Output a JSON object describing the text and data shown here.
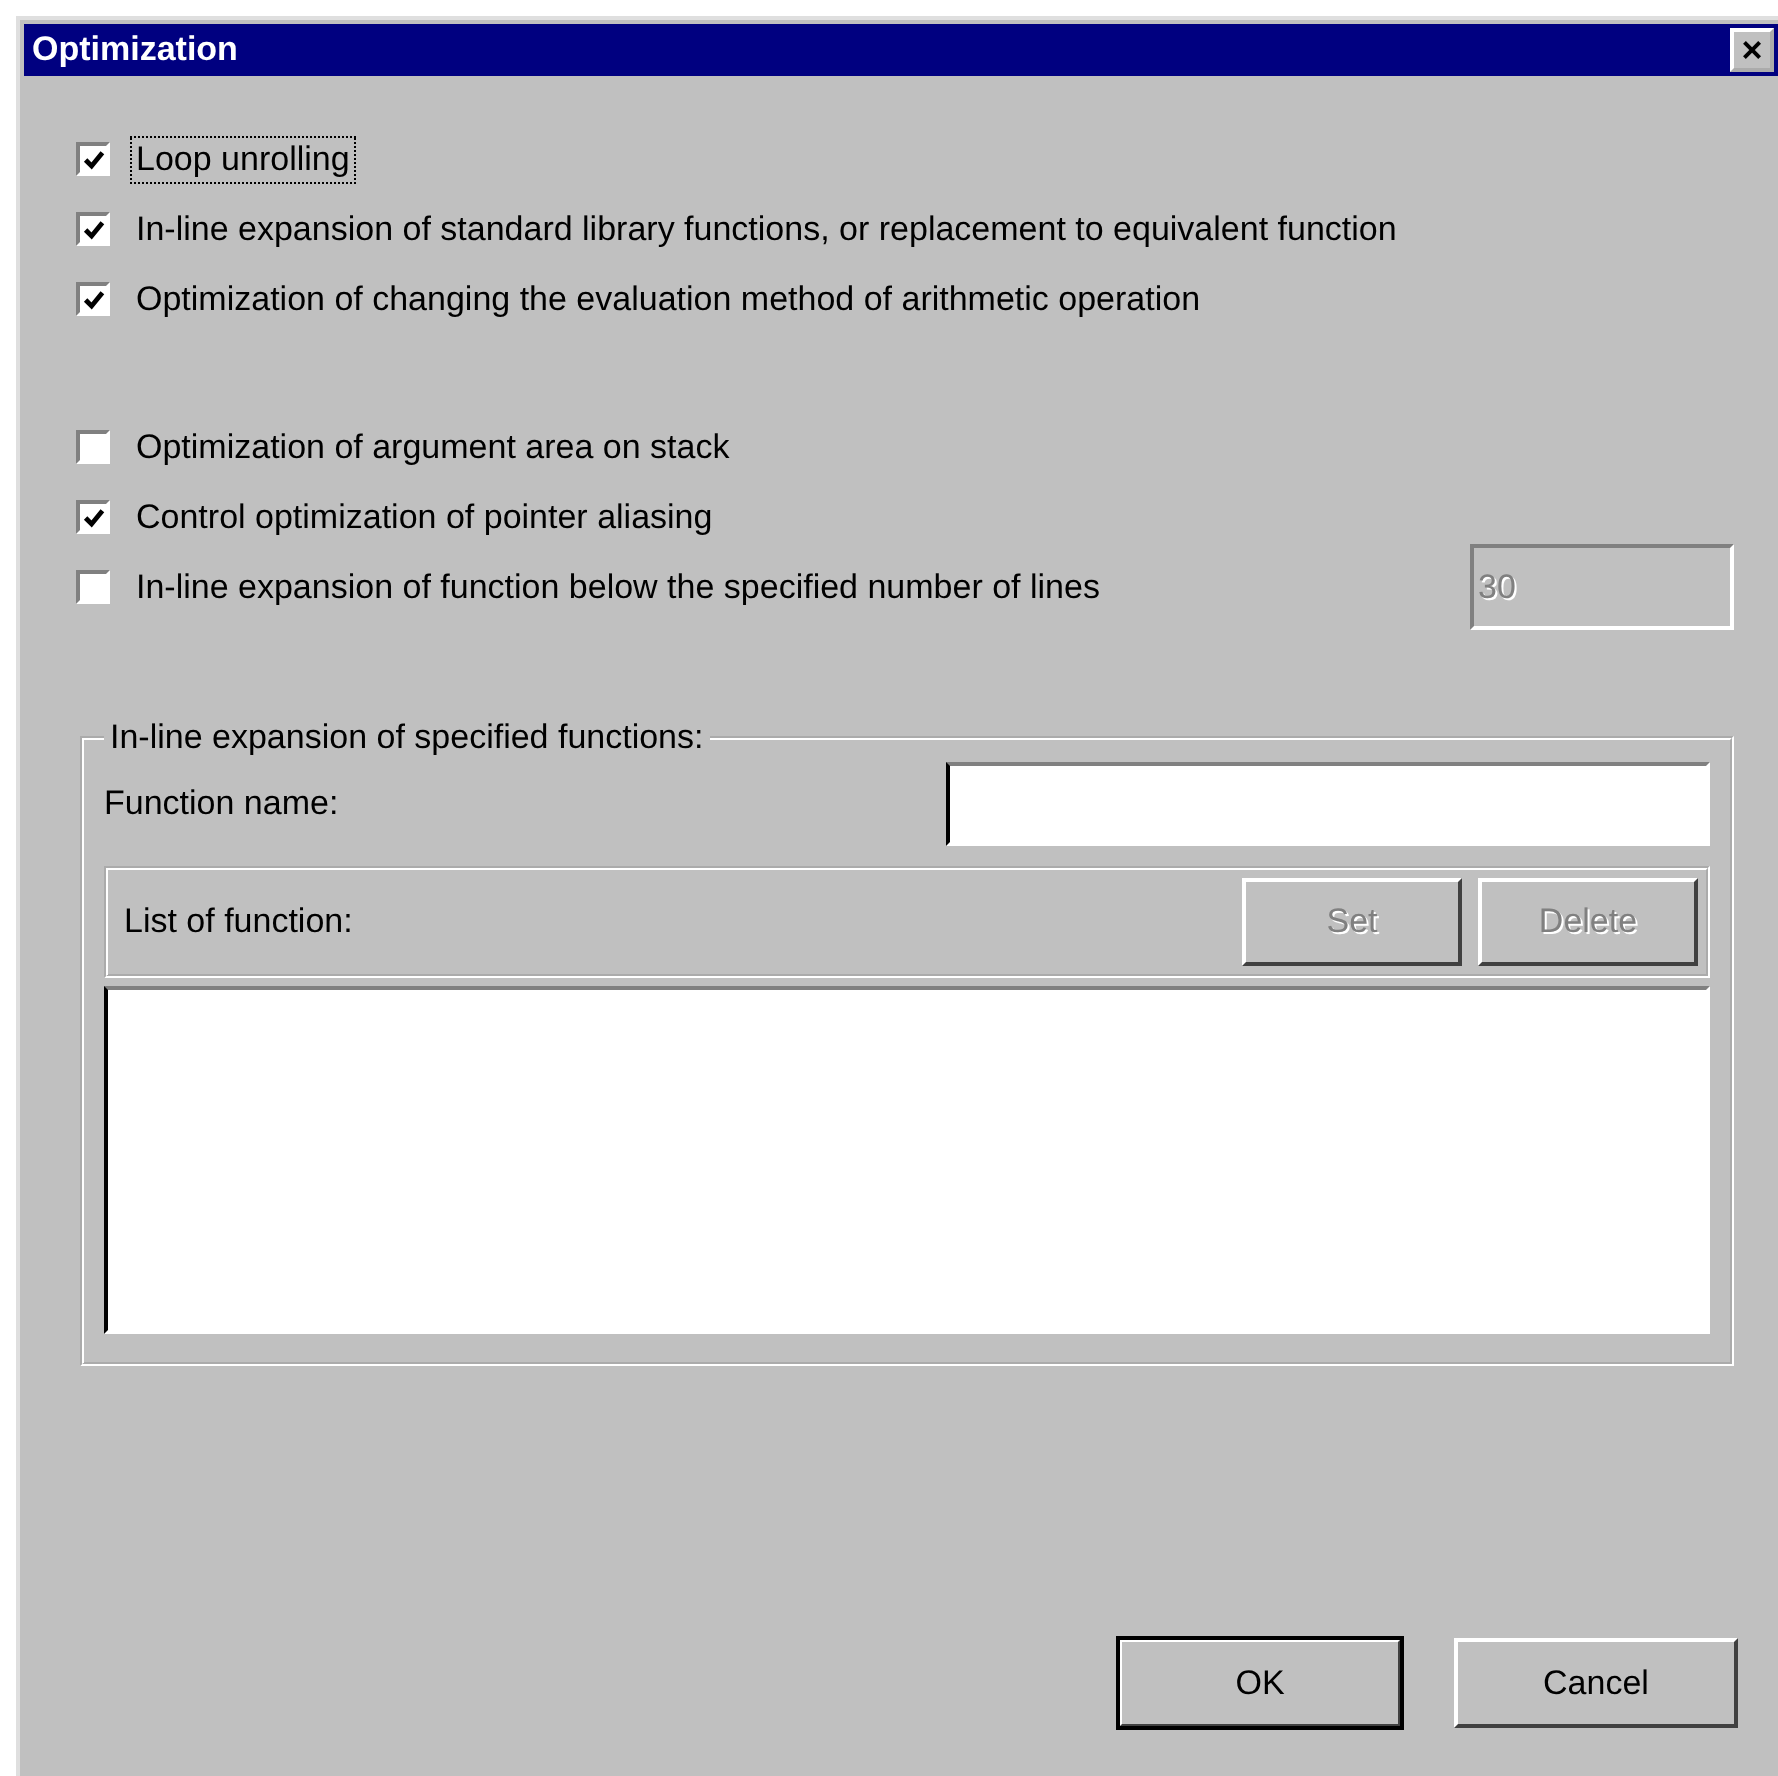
{
  "window": {
    "title": "Optimization",
    "close": "×"
  },
  "option_groups": [
    {
      "options": [
        {
          "label": "Loop unrolling",
          "checked": true,
          "focused": true
        },
        {
          "label": "In-line expansion of standard library functions, or replacement to equivalent function",
          "checked": true,
          "focused": false
        },
        {
          "label": "Optimization of changing the evaluation method of arithmetic operation",
          "checked": true,
          "focused": false
        }
      ]
    },
    {
      "options": [
        {
          "label": "Optimization of argument area on stack",
          "checked": false,
          "focused": false
        },
        {
          "label": "Control optimization of pointer aliasing",
          "checked": true,
          "focused": false
        },
        {
          "label": "In-line expansion of function below the specified number of lines",
          "checked": false,
          "focused": false
        }
      ]
    }
  ],
  "line_limit_field": {
    "value": "30",
    "disabled": true
  },
  "group_box": {
    "title": "In-line expansion of specified functions:",
    "function_name": {
      "label": "Function name:"
    },
    "list_header": {
      "label": "List of function:"
    },
    "buttons": [
      {
        "label": "Set",
        "disabled": true
      },
      {
        "label": "Delete",
        "disabled": true
      }
    ]
  },
  "buttons": [
    {
      "label": "OK",
      "default": true
    },
    {
      "label": "Cancel",
      "default": false
    }
  ]
}
